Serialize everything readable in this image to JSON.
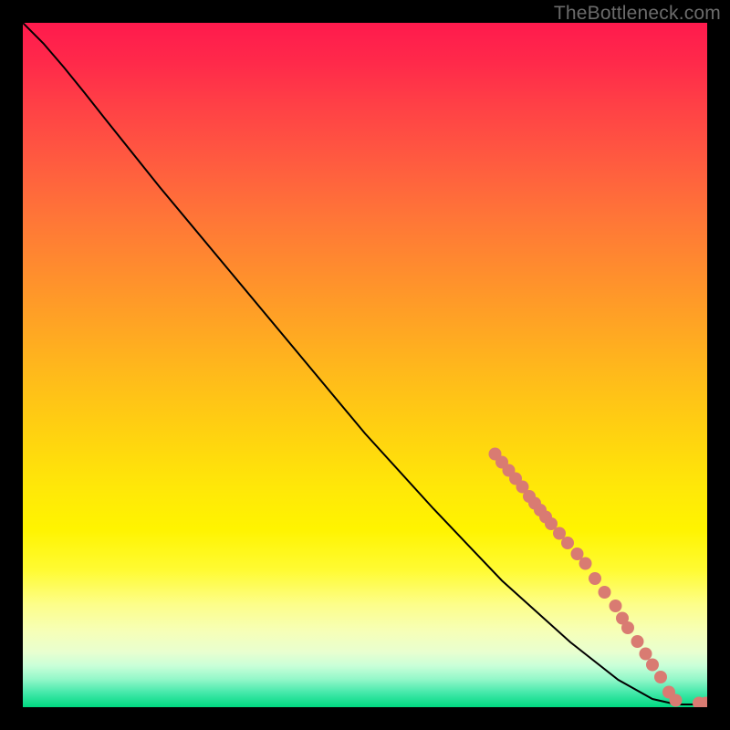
{
  "watermark": "TheBottleneck.com",
  "chart_data": {
    "type": "line",
    "title": "",
    "xlabel": "",
    "ylabel": "",
    "xlim": [
      0,
      1
    ],
    "ylim": [
      0,
      1
    ],
    "grid": false,
    "legend": false,
    "series": [
      {
        "name": "curve",
        "type": "line",
        "color": "#000000",
        "points": [
          {
            "x": 0.0,
            "y": 1.0
          },
          {
            "x": 0.03,
            "y": 0.97
          },
          {
            "x": 0.06,
            "y": 0.935
          },
          {
            "x": 0.09,
            "y": 0.898
          },
          {
            "x": 0.12,
            "y": 0.86
          },
          {
            "x": 0.2,
            "y": 0.76
          },
          {
            "x": 0.3,
            "y": 0.64
          },
          {
            "x": 0.4,
            "y": 0.52
          },
          {
            "x": 0.5,
            "y": 0.4
          },
          {
            "x": 0.6,
            "y": 0.29
          },
          {
            "x": 0.7,
            "y": 0.185
          },
          {
            "x": 0.8,
            "y": 0.095
          },
          {
            "x": 0.87,
            "y": 0.04
          },
          {
            "x": 0.92,
            "y": 0.012
          },
          {
            "x": 0.955,
            "y": 0.004
          },
          {
            "x": 0.97,
            "y": 0.004
          },
          {
            "x": 1.0,
            "y": 0.004
          }
        ]
      },
      {
        "name": "markers",
        "type": "scatter",
        "color": "#d97b72",
        "radius_px": 7,
        "points": [
          {
            "x": 0.69,
            "y": 0.37
          },
          {
            "x": 0.7,
            "y": 0.358
          },
          {
            "x": 0.71,
            "y": 0.346
          },
          {
            "x": 0.72,
            "y": 0.334
          },
          {
            "x": 0.73,
            "y": 0.322
          },
          {
            "x": 0.74,
            "y": 0.308
          },
          {
            "x": 0.748,
            "y": 0.298
          },
          {
            "x": 0.756,
            "y": 0.288
          },
          {
            "x": 0.764,
            "y": 0.278
          },
          {
            "x": 0.772,
            "y": 0.268
          },
          {
            "x": 0.784,
            "y": 0.254
          },
          {
            "x": 0.796,
            "y": 0.24
          },
          {
            "x": 0.81,
            "y": 0.224
          },
          {
            "x": 0.822,
            "y": 0.21
          },
          {
            "x": 0.836,
            "y": 0.188
          },
          {
            "x": 0.85,
            "y": 0.168
          },
          {
            "x": 0.866,
            "y": 0.148
          },
          {
            "x": 0.876,
            "y": 0.13
          },
          {
            "x": 0.884,
            "y": 0.116
          },
          {
            "x": 0.898,
            "y": 0.096
          },
          {
            "x": 0.91,
            "y": 0.078
          },
          {
            "x": 0.92,
            "y": 0.062
          },
          {
            "x": 0.932,
            "y": 0.044
          },
          {
            "x": 0.944,
            "y": 0.022
          },
          {
            "x": 0.954,
            "y": 0.01
          },
          {
            "x": 0.988,
            "y": 0.006
          },
          {
            "x": 0.998,
            "y": 0.006
          }
        ]
      }
    ]
  }
}
